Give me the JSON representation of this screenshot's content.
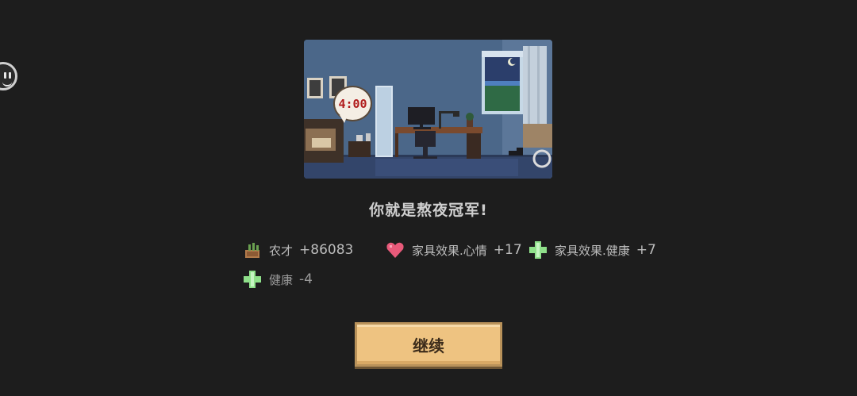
{
  "scene": {
    "clock_time": "4:00"
  },
  "title": "你就是熬夜冠军!",
  "rewards": [
    {
      "icon": "plant-pot-icon",
      "label": "农才",
      "value": "+86083"
    },
    {
      "icon": "heart-icon",
      "label": "家具效果.心情",
      "value": "+17"
    },
    {
      "icon": "health-cross-icon",
      "label": "家具效果.健康",
      "value": "+7"
    },
    {
      "icon": "health-cross-icon",
      "label": "健康",
      "value": "-4"
    }
  ],
  "continue_button": {
    "label": "继续"
  },
  "colors": {
    "background": "#1d1d1d",
    "button": "#eec381",
    "clock_text": "#b01c1c",
    "heart": "#e85a7a",
    "cross": "#8fe08a"
  }
}
